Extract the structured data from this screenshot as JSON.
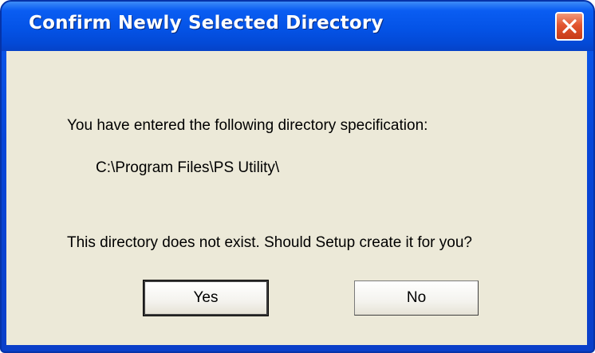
{
  "window": {
    "title": "Confirm Newly Selected Directory",
    "close_icon": "close-x-icon"
  },
  "message": {
    "line1": "You have entered the following directory specification:",
    "path": "C:\\Program Files\\PS Utility\\",
    "line2": "This directory does not exist.  Should Setup create it for you?"
  },
  "buttons": {
    "yes_label": "Yes",
    "no_label": "No"
  },
  "colors": {
    "titlebar": "#0453e6",
    "client_background": "#ece9d8",
    "close_button": "#e2552f"
  }
}
